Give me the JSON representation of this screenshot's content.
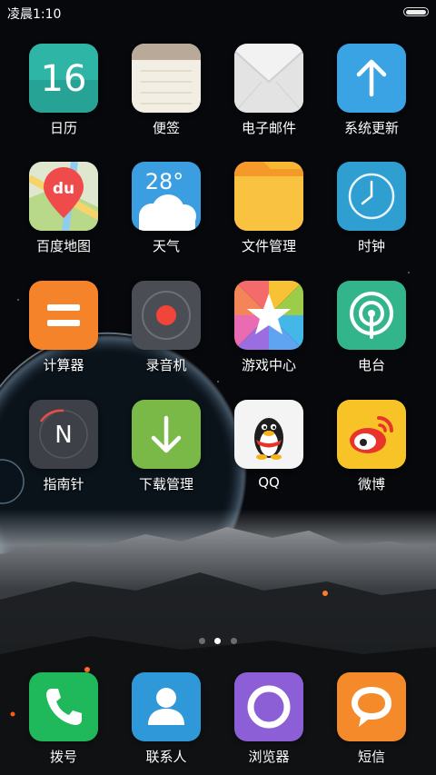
{
  "status_bar": {
    "time": "凌晨1:10"
  },
  "apps": {
    "calendar": {
      "label": "日历",
      "day": "16",
      "color": "#2fb5a6"
    },
    "notes": {
      "label": "便签"
    },
    "email": {
      "label": "电子邮件"
    },
    "system_update": {
      "label": "系统更新",
      "color": "#3aa3e3"
    },
    "baidu_map": {
      "label": "百度地图",
      "icon_text": "du"
    },
    "weather": {
      "label": "天气",
      "temperature": "28°",
      "color": "#3a9ee0"
    },
    "file_manager": {
      "label": "文件管理",
      "color": "#f7b733"
    },
    "clock": {
      "label": "时钟",
      "color": "#2f9fd2"
    },
    "calculator": {
      "label": "计算器",
      "color": "#f5832a"
    },
    "recorder": {
      "label": "录音机",
      "color": "#4a4d53"
    },
    "game_center": {
      "label": "游戏中心"
    },
    "radio": {
      "label": "电台",
      "color": "#33b58c"
    },
    "compass": {
      "label": "指南针",
      "icon_text": "N",
      "color": "#3d4046"
    },
    "download_manager": {
      "label": "下载管理",
      "color": "#7ab948"
    },
    "qq": {
      "label": "QQ"
    },
    "weibo": {
      "label": "微博",
      "color": "#f7c326"
    }
  },
  "dock": {
    "phone": {
      "label": "拨号",
      "color": "#1fb85a"
    },
    "contacts": {
      "label": "联系人",
      "color": "#2f98d8"
    },
    "browser": {
      "label": "浏览器",
      "color": "#8c5fd6"
    },
    "messages": {
      "label": "短信",
      "color": "#f58a2a"
    }
  },
  "page_indicator": {
    "page_count": 3,
    "current_page": 2
  }
}
